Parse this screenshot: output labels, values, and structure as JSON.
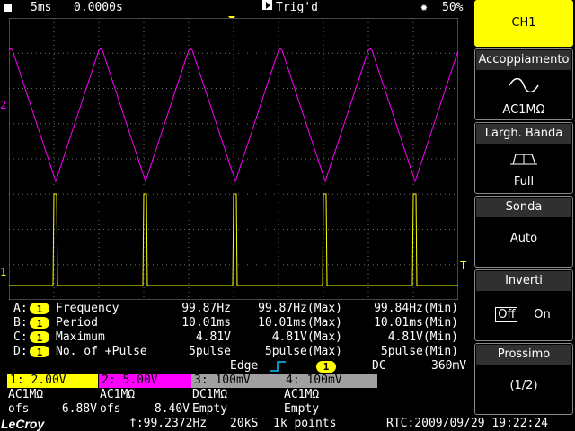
{
  "top_bar": {
    "timebase": "5ms",
    "delay": "0.0000s",
    "trigger_status": "Trig'd",
    "battery": "50%"
  },
  "markers": {
    "ch2_ground": "2",
    "ch1_ground": "1",
    "trigger_level": "T"
  },
  "measurements": [
    {
      "slot": "A:",
      "channel": "1",
      "name": "Frequency",
      "value": "99.87Hz",
      "max": "99.87Hz(Max)",
      "min": "99.84Hz(Min)"
    },
    {
      "slot": "B:",
      "channel": "1",
      "name": "Period",
      "value": "10.01ms",
      "max": "10.01ms(Max)",
      "min": "10.01ms(Min)"
    },
    {
      "slot": "C:",
      "channel": "1",
      "name": "Maximum",
      "value": "4.81V",
      "max": "4.81V(Max)",
      "min": "4.81V(Min)"
    },
    {
      "slot": "D:",
      "channel": "1",
      "name": "No. of +Pulse",
      "value": "5pulse",
      "max": "5pulse(Max)",
      "min": "5pulse(Min)"
    }
  ],
  "trigger": {
    "type": "Edge",
    "source": "1",
    "coupling": "DC",
    "level": "360mV"
  },
  "channels": [
    {
      "label": "1: 2.00V",
      "coupling": "AC1MΩ",
      "offset_label": "ofs",
      "offset": "-6.88V",
      "color": "#ffff00"
    },
    {
      "label": "2: 5.00V",
      "coupling": "AC1MΩ",
      "offset_label": "ofs",
      "offset": "8.40V",
      "color": "#ff00ff"
    },
    {
      "label": "3: 100mV",
      "coupling": "DC1MΩ",
      "offset_label": "Empty",
      "offset": "",
      "color": "#a0a0a0"
    },
    {
      "label": "4: 100mV",
      "coupling": "AC1MΩ",
      "offset_label": "Empty",
      "offset": "",
      "color": "#a0a0a0"
    }
  ],
  "bottom_bar": {
    "brand": "LeCroy",
    "frequency": "f:99.2372Hz",
    "sample_rate": "20kS",
    "points": "1k points",
    "clock": "RTC:2009/09/29 19:22:24"
  },
  "side_menu": {
    "channel": "CH1",
    "coupling_title": "Accoppiamento",
    "coupling_value": "AC1MΩ",
    "bandwidth_title": "Largh. Banda",
    "bandwidth_value": "Full",
    "probe_title": "Sonda",
    "probe_value": "Auto",
    "invert_title": "Inverti",
    "invert_off": "Off",
    "invert_on": "On",
    "next_title": "Prossimo",
    "next_page": "(1/2)"
  },
  "colors": {
    "ch1": "#ffff00",
    "ch2": "#ff00ff",
    "menu_highlight": "#ffff00",
    "grid": "#8a8a8a"
  }
}
